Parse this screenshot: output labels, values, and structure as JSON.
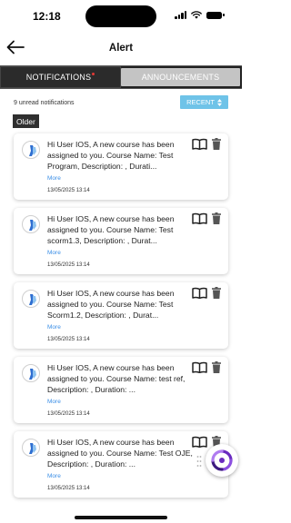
{
  "status_bar": {
    "time": "12:18"
  },
  "header": {
    "title": "Alert"
  },
  "tabs": [
    {
      "label": "NOTIFICATIONS",
      "active": true,
      "has_dot": true
    },
    {
      "label": "ANNOUNCEMENTS",
      "active": false
    }
  ],
  "list_info": {
    "unread_text": "9 unread notifications",
    "sort_label": "RECENT",
    "group_label": "Older"
  },
  "notifications": [
    {
      "message": "Hi User IOS, A new course has been assigned to you. Course Name: Test Program, Description: , Durati...",
      "more": "More",
      "timestamp": "13/05/2025 13:14"
    },
    {
      "message": "Hi User IOS, A new course has been assigned to you. Course Name: Test scorm1.3, Description: , Durat...",
      "more": "More",
      "timestamp": "13/05/2025 13:14"
    },
    {
      "message": "Hi User IOS, A new course has been assigned to you. Course Name: Test Scorm1.2, Description: , Durat...",
      "more": "More",
      "timestamp": "13/05/2025 13:14"
    },
    {
      "message": "Hi User IOS, A new course has been assigned to you. Course Name: test ref, Description: , Duration: ...",
      "more": "More",
      "timestamp": "13/05/2025 13:14"
    },
    {
      "message": "Hi User IOS, A new course has been assigned to you. Course Name: Test OJE, Description: , Duration: ...",
      "more": "More",
      "timestamp": "13/05/2025 13:14"
    }
  ],
  "colors": {
    "tab_bar": "#222222",
    "tab_inactive": "#c4c4c4",
    "sort_button": "#6fc3e8",
    "link": "#3a8ee6",
    "unread_dot": "#e53935",
    "fab_accent": "#6a2bbf"
  },
  "icons": {
    "back": "arrow-left-icon",
    "card_book": "book-open-icon",
    "card_delete": "trash-icon",
    "fab": "spinner-logo-icon"
  }
}
